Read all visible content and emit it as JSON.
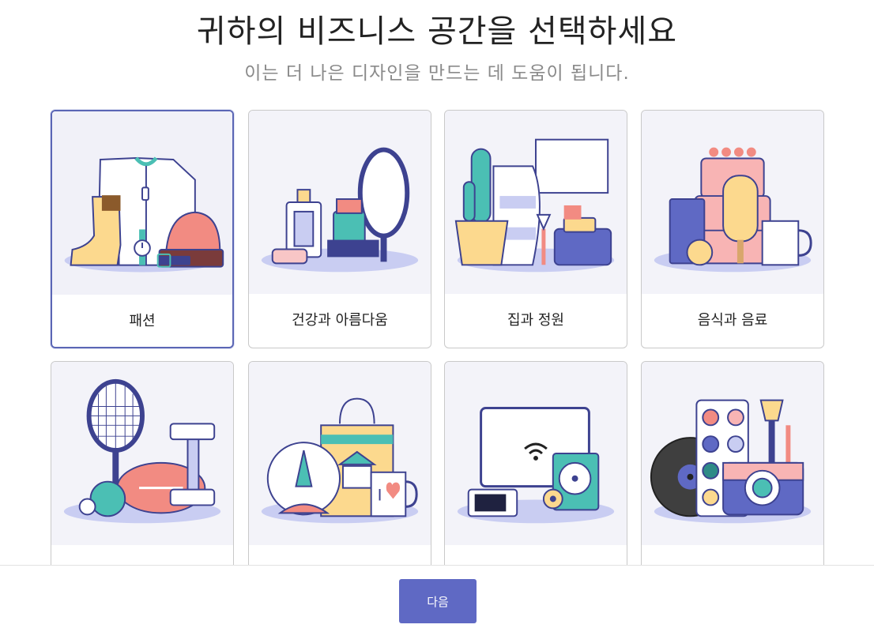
{
  "header": {
    "title": "귀하의 비즈니스 공간을 선택하세요",
    "subtitle": "이는 더 나은 디자인을 만드는 데 도움이 됩니다."
  },
  "categories": [
    {
      "label": "패션",
      "icon": "fashion-illustration",
      "selected": true
    },
    {
      "label": "건강과 아름다움",
      "icon": "health-beauty-illustration",
      "selected": false
    },
    {
      "label": "집과 정원",
      "icon": "home-garden-illustration",
      "selected": false
    },
    {
      "label": "음식과 음료",
      "icon": "food-drink-illustration",
      "selected": false
    },
    {
      "label": "",
      "icon": "sports-illustration",
      "selected": false
    },
    {
      "label": "",
      "icon": "gifts-illustration",
      "selected": false
    },
    {
      "label": "",
      "icon": "electronics-illustration",
      "selected": false
    },
    {
      "label": "",
      "icon": "arts-entertainment-illustration",
      "selected": false
    }
  ],
  "footer": {
    "next_label": "다음"
  },
  "colors": {
    "accent": "#5f69c4",
    "selected_border": "#5b66b5",
    "navy": "#3d4290",
    "teal": "#4bbfb4",
    "coral": "#f28b82",
    "yellow": "#fcd98e",
    "lavender": "#c9cdf2"
  }
}
